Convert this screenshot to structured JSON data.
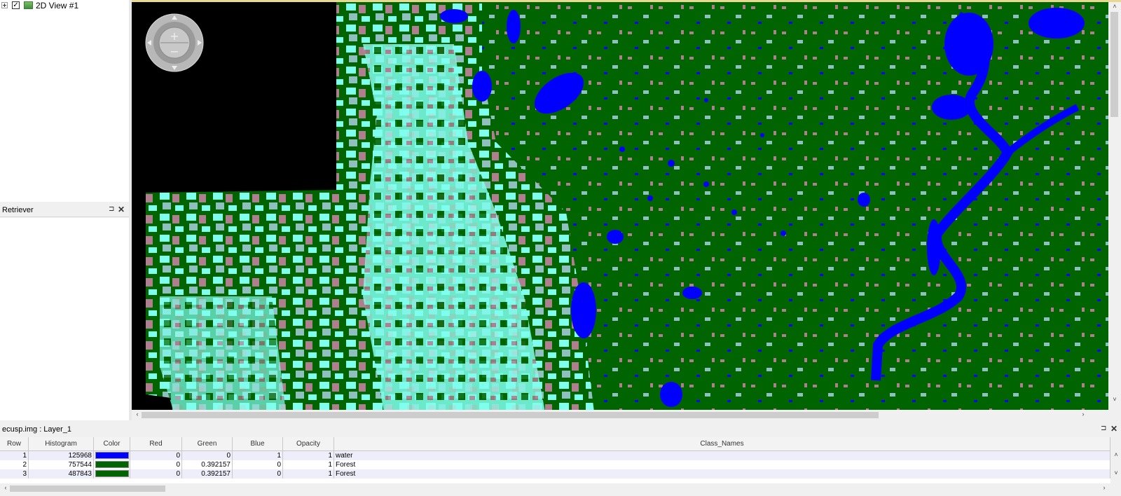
{
  "contents": {
    "view_label": "2D View #1",
    "checked": "✓"
  },
  "retriever": {
    "title": "Retriever",
    "pin": "⊐",
    "close": "✕"
  },
  "table_pane": {
    "title": "ecusp.img : Layer_1",
    "pin": "⊐",
    "close": "✕"
  },
  "attribute_table": {
    "columns": [
      "Row",
      "Histogram",
      "Color",
      "Red",
      "Green",
      "Blue",
      "Opacity",
      "Class_Names"
    ],
    "rows": [
      {
        "row": "1",
        "histogram": "125968",
        "color": "#0000ff",
        "red": "0",
        "green": "0",
        "blue": "1",
        "opacity": "1",
        "class_name": "water"
      },
      {
        "row": "2",
        "histogram": "757544",
        "color": "#006400",
        "red": "0",
        "green": "0.392157",
        "blue": "0",
        "opacity": "1",
        "class_name": "Forest"
      },
      {
        "row": "3",
        "histogram": "487843",
        "color": "#006400",
        "red": "0",
        "green": "0.392157",
        "blue": "0",
        "opacity": "1",
        "class_name": "Forest"
      }
    ]
  },
  "map": {
    "colors": {
      "water": "#0000ff",
      "forest": "#006400",
      "open": "#7fffee",
      "urban": "#b07f8f",
      "background": "#000000"
    }
  },
  "icons": {
    "scroll_up": "˄",
    "scroll_down": "˅",
    "scroll_left": "‹",
    "scroll_right": "›"
  }
}
